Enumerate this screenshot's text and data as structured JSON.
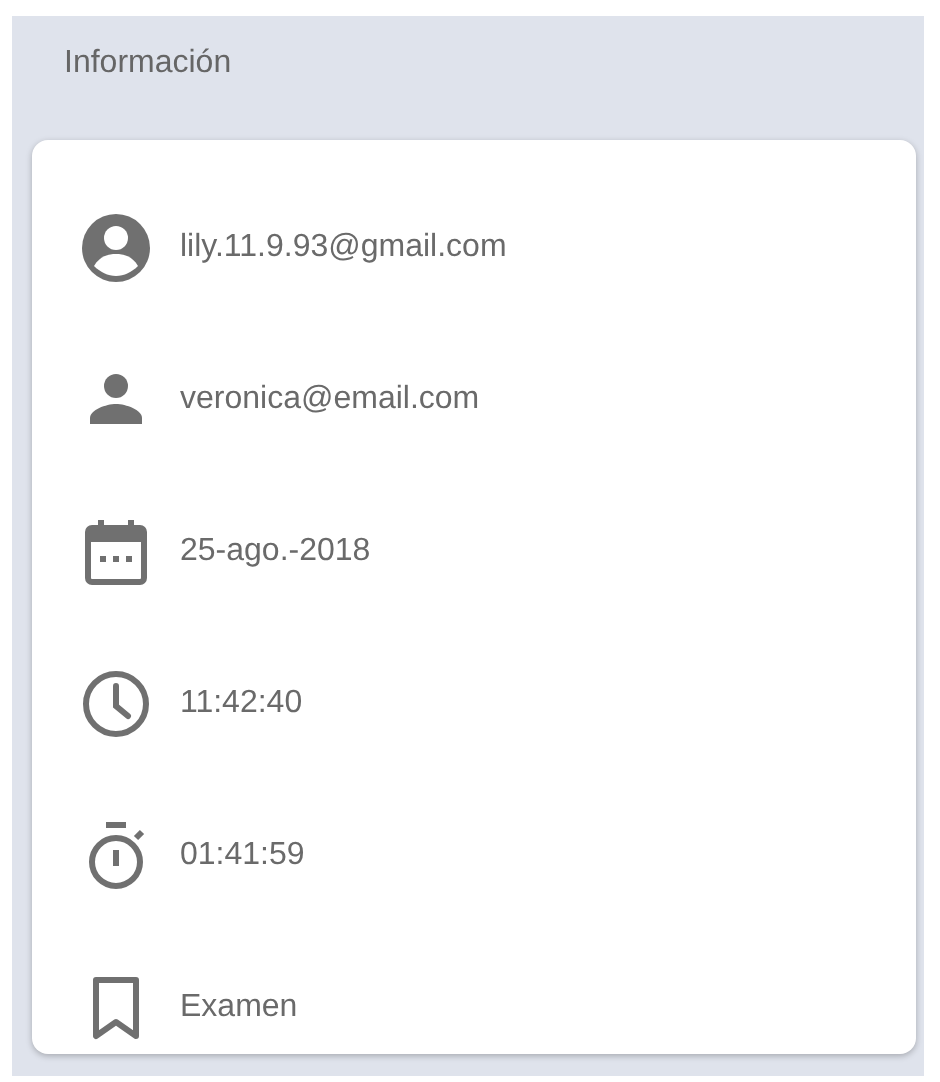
{
  "section": {
    "title": "Información"
  },
  "rows": [
    {
      "kind": "account",
      "text": "lily.11.9.93@gmail.com"
    },
    {
      "kind": "user",
      "text": "veronica@email.com"
    },
    {
      "kind": "date",
      "text": "25-ago.-2018"
    },
    {
      "kind": "time",
      "text": "11:42:40"
    },
    {
      "kind": "duration",
      "text": "01:41:59"
    },
    {
      "kind": "category",
      "text": "Examen"
    }
  ]
}
